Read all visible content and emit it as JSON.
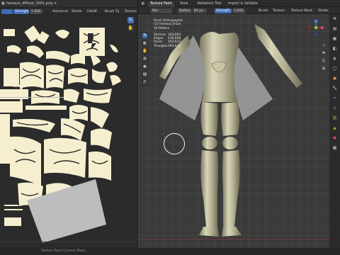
{
  "image_editor": {
    "image_name": "hereaut_diffuse_1001.png",
    "header_icons": [
      "image-icon",
      "close-icon"
    ],
    "toolbar": {
      "strength_label": "Strength",
      "strength_value": "1.000",
      "advanced_label": "Advanced",
      "stroke_label": "Stroke",
      "falloff_label": "Falloff",
      "brush_tip_label": "Brush Tip",
      "texture_label": "Texture"
    }
  },
  "viewport": {
    "tabs": [
      "Texture Paint",
      "View",
      "Validation Tool",
      "Import & Validate"
    ],
    "toolbar": {
      "mix_label": "Mix",
      "radius_label": "Radius",
      "radius_value": "91 px",
      "strength_label": "Strength",
      "strength_value": "1.000",
      "brush_label": "Brush",
      "texture_label": "Texture",
      "texture_mask_label": "Texture Mask",
      "stroke_label": "Stroke"
    },
    "overlay": {
      "view_name": "Front Orthographic",
      "object_name": "(1) Hereaut_thick",
      "scale": "10 Meters",
      "stats": [
        {
          "label": "Vertices",
          "value": "344,863"
        },
        {
          "label": "Edges",
          "value": "636,806"
        },
        {
          "label": "Faces",
          "value": "593,622"
        },
        {
          "label": "Triangles",
          "value": "593,622"
        }
      ]
    }
  },
  "status_bar": {
    "text": "Texture Paint Context Menu"
  },
  "colors": {
    "accent": "#4772b3",
    "uv_islands": "#f5efcf",
    "mesh": "#c6c3a2",
    "axis_x": "#e0435a",
    "axis_y": "#8ccb3c",
    "axis_z": "#3c8be0"
  }
}
